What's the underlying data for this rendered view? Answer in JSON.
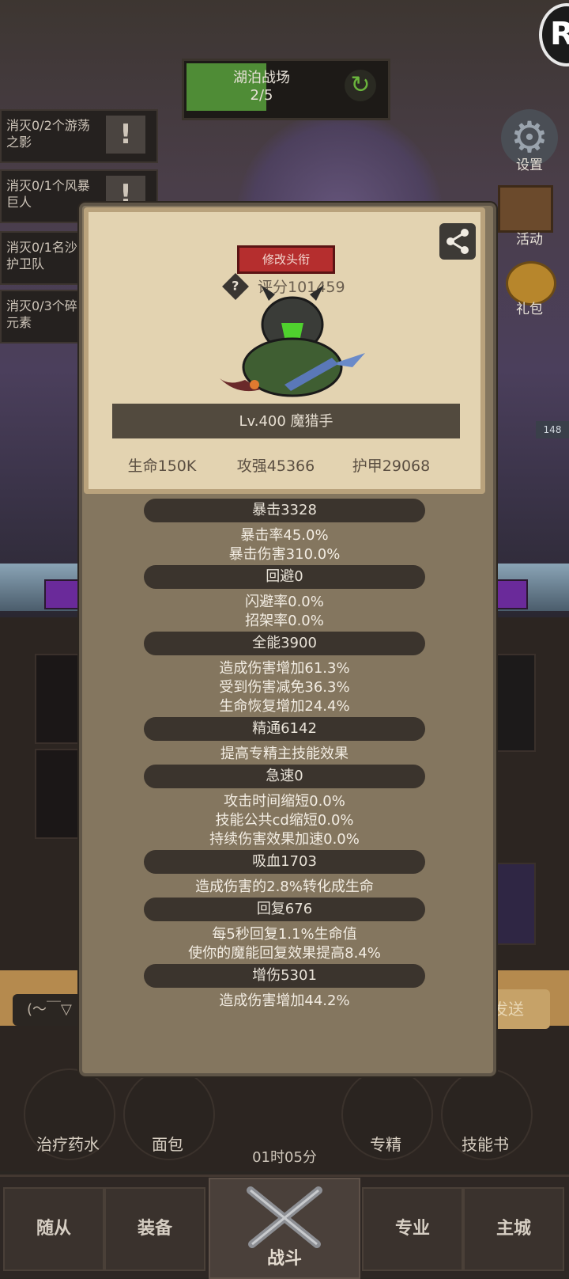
{
  "top": {
    "stage_name": "湖泊战场",
    "stage_progress": "2/5",
    "stage_progress_value": 0.4,
    "logo_text": "R"
  },
  "quests": [
    {
      "text": "消灭0/2个游荡之影",
      "icon": "!"
    },
    {
      "text": "消灭0/1个风暴巨人",
      "icon": "!"
    },
    {
      "text": "消灭0/1名沙漠护卫队",
      "icon": ""
    },
    {
      "text": "消灭0/3个碎石元素",
      "icon": ""
    }
  ],
  "side_buttons": {
    "settings": "设置",
    "activity": "活动",
    "gift": "礼包"
  },
  "side_badge": "148",
  "card": {
    "title_button": "修改头衔",
    "score": "评分101459",
    "level_name": "Lv.400 魔猎手",
    "core_stats": [
      "生命150K",
      "攻强45366",
      "护甲29068"
    ]
  },
  "stat_sections": [
    {
      "header": "暴击3328",
      "lines": [
        "暴击率45.0%",
        "暴击伤害310.0%"
      ]
    },
    {
      "header": "回避0",
      "lines": [
        "闪避率0.0%",
        "招架率0.0%"
      ]
    },
    {
      "header": "全能3900",
      "lines": [
        "造成伤害增加61.3%",
        "受到伤害减免36.3%",
        "生命恢复增加24.4%"
      ]
    },
    {
      "header": "精通6142",
      "lines": [
        "提高专精主技能效果"
      ]
    },
    {
      "header": "急速0",
      "lines": [
        "攻击时间缩短0.0%",
        "技能公共cd缩短0.0%",
        "持续伤害效果加速0.0%"
      ]
    },
    {
      "header": "吸血1703",
      "lines": [
        "造成伤害的2.8%转化成生命"
      ]
    },
    {
      "header": "回复676",
      "lines": [
        "每5秒回复1.1%生命值",
        "使你的魔能回复效果提高8.4%"
      ]
    },
    {
      "header": "增伤5301",
      "lines": [
        "造成伤害增加44.2%"
      ]
    }
  ],
  "chat": {
    "input_text": "(～￣▽",
    "send_label": "发送"
  },
  "quick_bar": {
    "potion": "治疗药水",
    "bread": "面包",
    "timer": "01时05分",
    "spec": "专精",
    "skillbook": "技能书"
  },
  "nav": {
    "followers": "随从",
    "equipment": "装备",
    "battle": "战斗",
    "profession": "专业",
    "city": "主城"
  },
  "colors": {
    "card_bg": "#e3d3b1",
    "modal_bg": "#84765f",
    "title_red": "#b52e2e",
    "progress_green": "#4f8c36"
  }
}
